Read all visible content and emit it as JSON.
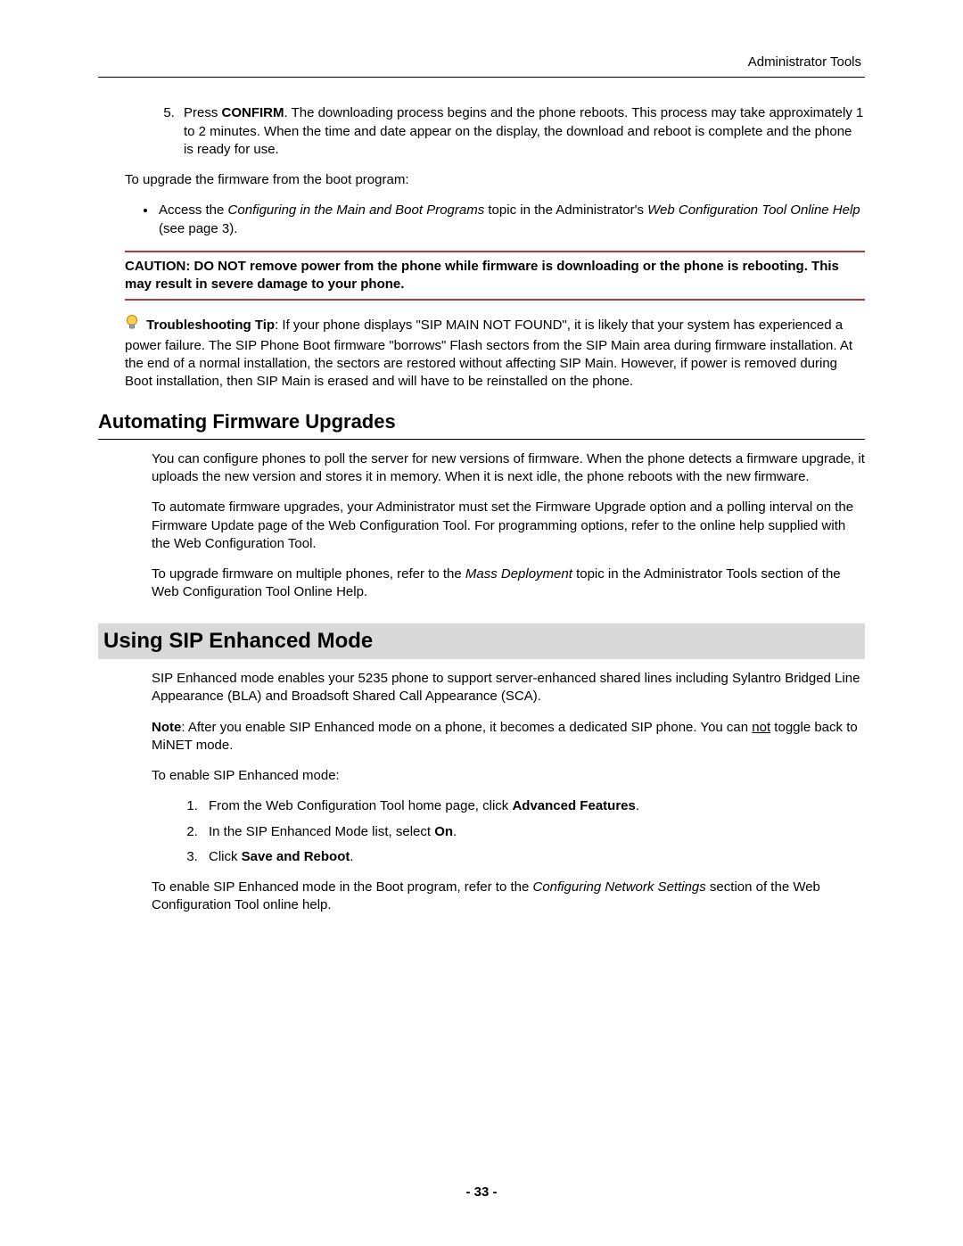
{
  "header": {
    "right": "Administrator Tools"
  },
  "step5": {
    "num": "5.",
    "pre": "Press ",
    "confirm": "CONFIRM",
    "post": ". The downloading process begins and the phone reboots. This process may take approximately 1 to 2 minutes. When the time and date appear on the display, the download and reboot is complete and the phone is ready for use."
  },
  "para_boot": "To upgrade the firmware from the boot program:",
  "bullet_access": {
    "pre": "Access the ",
    "it1": "Configuring in the Main and Boot Programs",
    "mid": " topic in the Administrator's ",
    "it2": "Web Configuration Tool Online Help",
    "post": " (see page 3)."
  },
  "caution": "CAUTION: DO NOT remove power from the phone while firmware is downloading or the phone is rebooting. This may result in severe damage to your phone.",
  "tip": {
    "bold": "Troubleshooting Tip",
    "rest": ": If your phone displays \"SIP MAIN NOT FOUND\", it is likely that your system has experienced a power failure. The SIP Phone Boot firmware \"borrows\" Flash sectors from the SIP Main area during firmware installation. At the end of a normal installation, the sectors are restored without affecting SIP Main. However, if power is removed during Boot installation, then SIP Main is erased and will have to be reinstalled on the phone."
  },
  "h_auto": "Automating Firmware Upgrades",
  "auto_p1": "You can configure phones to poll the server for new versions of firmware. When the phone detects a firmware upgrade, it uploads the new version and stores it in memory. When it is next idle, the phone reboots with the new firmware.",
  "auto_p2": "To automate firmware upgrades, your Administrator must set the Firmware Upgrade option and a polling interval on the Firmware Update page of the Web Configuration Tool. For programming options, refer to the online help supplied with the Web Configuration Tool.",
  "auto_p3": {
    "pre": "To upgrade firmware on multiple phones, refer to the ",
    "it": "Mass Deployment",
    "post": " topic in the Administrator Tools section of the Web Configuration Tool Online Help."
  },
  "h_sip": "Using SIP Enhanced Mode",
  "sip_p1": "SIP Enhanced mode enables your 5235 phone to support server-enhanced shared lines including Sylantro Bridged Line Appearance (BLA) and Broadsoft Shared Call Appearance (SCA).",
  "sip_note": {
    "bold": "Note",
    "pre": ": After you enable SIP Enhanced mode on a phone, it becomes a dedicated SIP phone. You can ",
    "under": "not",
    "post": " toggle back to MiNET mode."
  },
  "sip_enable": "To enable SIP Enhanced mode:",
  "sip_steps": {
    "s1_pre": "From the Web Configuration Tool home page, click ",
    "s1_bold": "Advanced Features",
    "s1_post": ".",
    "s2_pre": "In the SIP Enhanced Mode list, select ",
    "s2_bold": "On",
    "s2_post": ".",
    "s3_pre": "Click ",
    "s3_bold": "Save and Reboot",
    "s3_post": "."
  },
  "sip_boot": {
    "pre": "To enable SIP Enhanced mode in the Boot program, refer to the ",
    "it": "Configuring Network Settings",
    "post": " section of the Web Configuration Tool online help."
  },
  "footer": "- 33 -"
}
